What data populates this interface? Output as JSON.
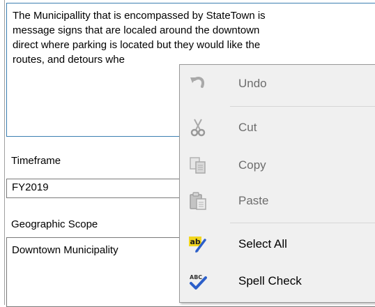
{
  "description": {
    "lines": [
      "The Municipallity that is encompassed by StateTown is",
      "message signs that are localed around the downtown",
      "direct where parking is located but they would like the",
      "routes, and detours whe"
    ]
  },
  "timeframe": {
    "label": "Timeframe",
    "value": "FY2019"
  },
  "geographic_scope": {
    "label": "Geographic Scope",
    "value": "Downtown Municipality"
  },
  "context_menu": {
    "items": [
      {
        "label": "Undo",
        "icon": "undo-icon",
        "enabled": false
      },
      {
        "label": "Cut",
        "icon": "scissors-icon",
        "enabled": false
      },
      {
        "label": "Copy",
        "icon": "copy-icon",
        "enabled": false
      },
      {
        "label": "Paste",
        "icon": "paste-icon",
        "enabled": false
      },
      {
        "label": "Select All",
        "icon": "select-all-icon",
        "enabled": true
      },
      {
        "label": "Spell Check",
        "icon": "spell-check-icon",
        "enabled": true
      }
    ]
  }
}
